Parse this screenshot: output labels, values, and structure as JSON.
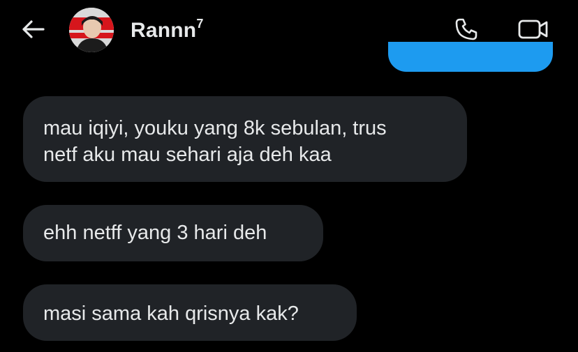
{
  "header": {
    "contact_name": "Rannn",
    "name_badge": "7",
    "back_icon": "arrow-left-icon",
    "call_icon": "phone-icon",
    "video_icon": "video-camera-icon"
  },
  "messages": [
    {
      "direction": "incoming",
      "lines": [
        "mau iqiyi, youku yang 8k sebulan, trus",
        "netf aku mau sehari aja deh kaa"
      ]
    },
    {
      "direction": "incoming",
      "lines": [
        "ehh netff yang 3 hari deh"
      ]
    },
    {
      "direction": "incoming",
      "lines": [
        "masi sama kah qrisnya kak?"
      ]
    }
  ],
  "colors": {
    "background": "#000000",
    "incoming_bubble": "#202327",
    "outgoing_bubble": "#1d9bf0",
    "text": "#e7e9ea"
  }
}
